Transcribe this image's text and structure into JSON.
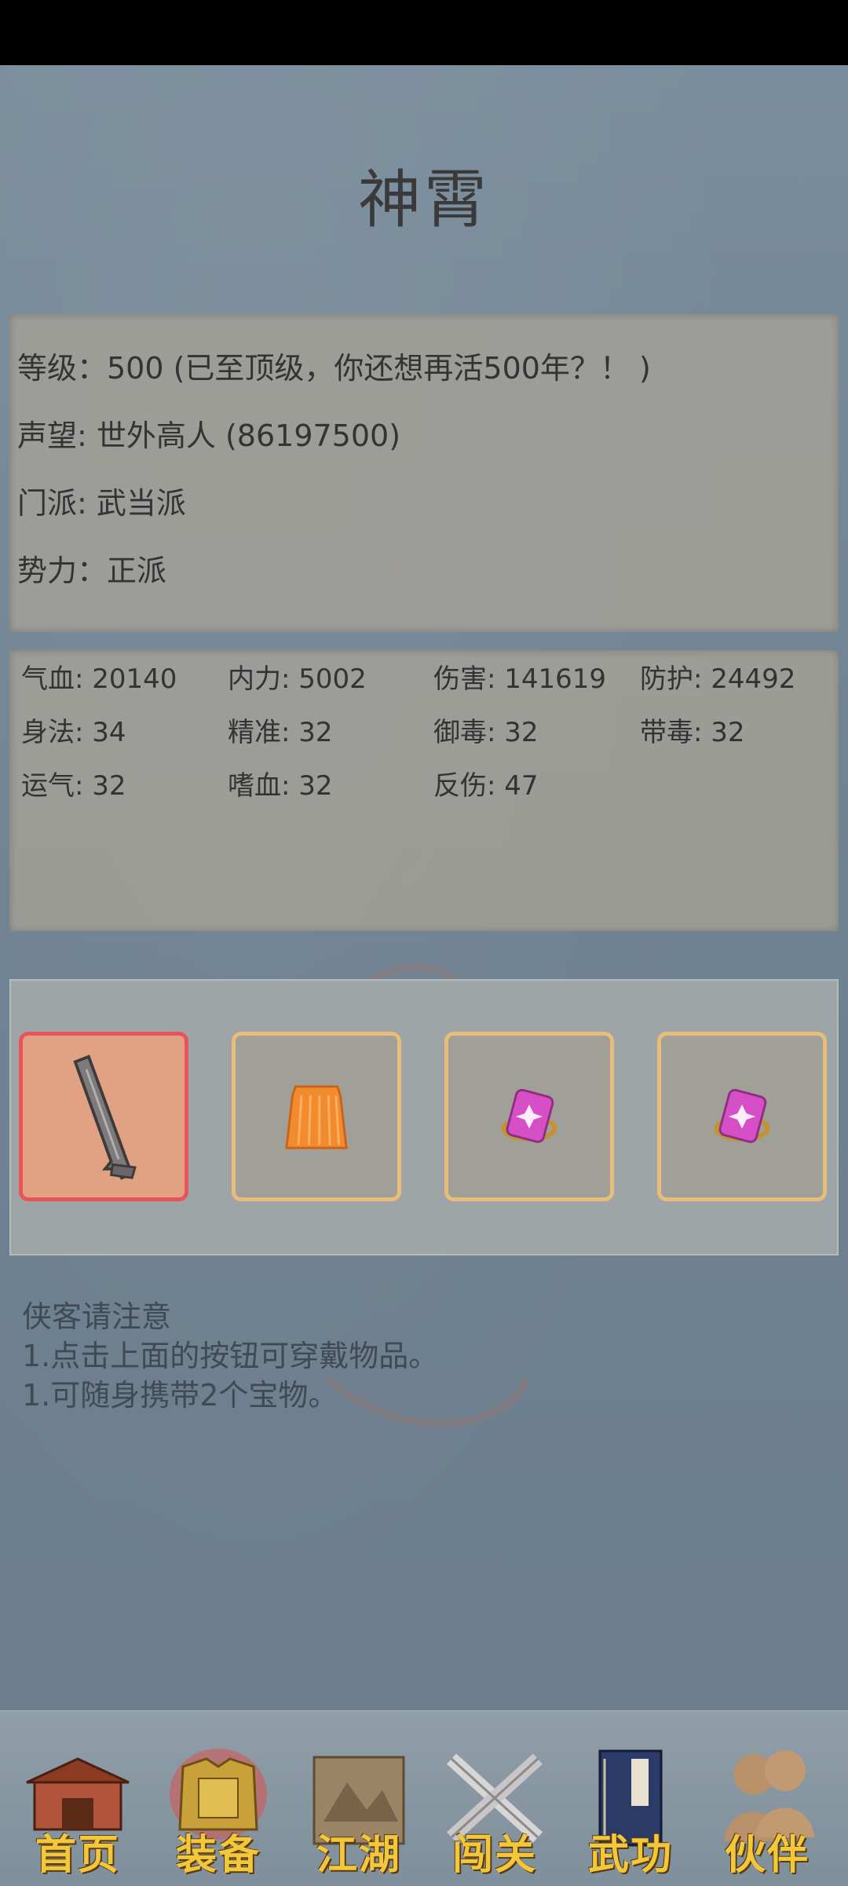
{
  "title": "神霄",
  "info": {
    "level": "等级：500 (已至顶级，你还想再活500年？！ )",
    "reputation": "声望: 世外高人 (86197500)",
    "sect": "门派: 武当派",
    "faction": "势力：正派"
  },
  "stats": [
    {
      "text": "气血: 20140"
    },
    {
      "text": "内力: 5002"
    },
    {
      "text": "伤害: 141619"
    },
    {
      "text": "防护: 24492"
    },
    {
      "text": "身法: 34"
    },
    {
      "text": "精准: 32"
    },
    {
      "text": "御毒: 32"
    },
    {
      "text": "带毒: 32"
    },
    {
      "text": "运气: 32"
    },
    {
      "text": "嗜血: 32"
    },
    {
      "text": "反伤: 47"
    }
  ],
  "equipment": [
    {
      "icon": "sword-icon",
      "selected": true
    },
    {
      "icon": "armor-icon",
      "selected": false
    },
    {
      "icon": "gem-treasure-icon",
      "selected": false
    },
    {
      "icon": "gem-treasure-icon",
      "selected": false
    }
  ],
  "notes": {
    "heading": "侠客请注意",
    "line1": "1.点击上面的按钮可穿戴物品。",
    "line2": "1.可随身携带2个宝物。"
  },
  "nav": [
    {
      "label": "首页",
      "icon": "home-building-icon"
    },
    {
      "label": "装备",
      "icon": "armor-icon",
      "active": true
    },
    {
      "label": "江湖",
      "icon": "scroll-map-icon"
    },
    {
      "label": "闯关",
      "icon": "crossed-swords-icon"
    },
    {
      "label": "武功",
      "icon": "book-icon"
    },
    {
      "label": "伙伴",
      "icon": "companions-icon"
    }
  ],
  "colors": {
    "accent_gold": "#f3c73a",
    "selected_border": "#e8545a",
    "slot_border": "#e8bd7a"
  }
}
